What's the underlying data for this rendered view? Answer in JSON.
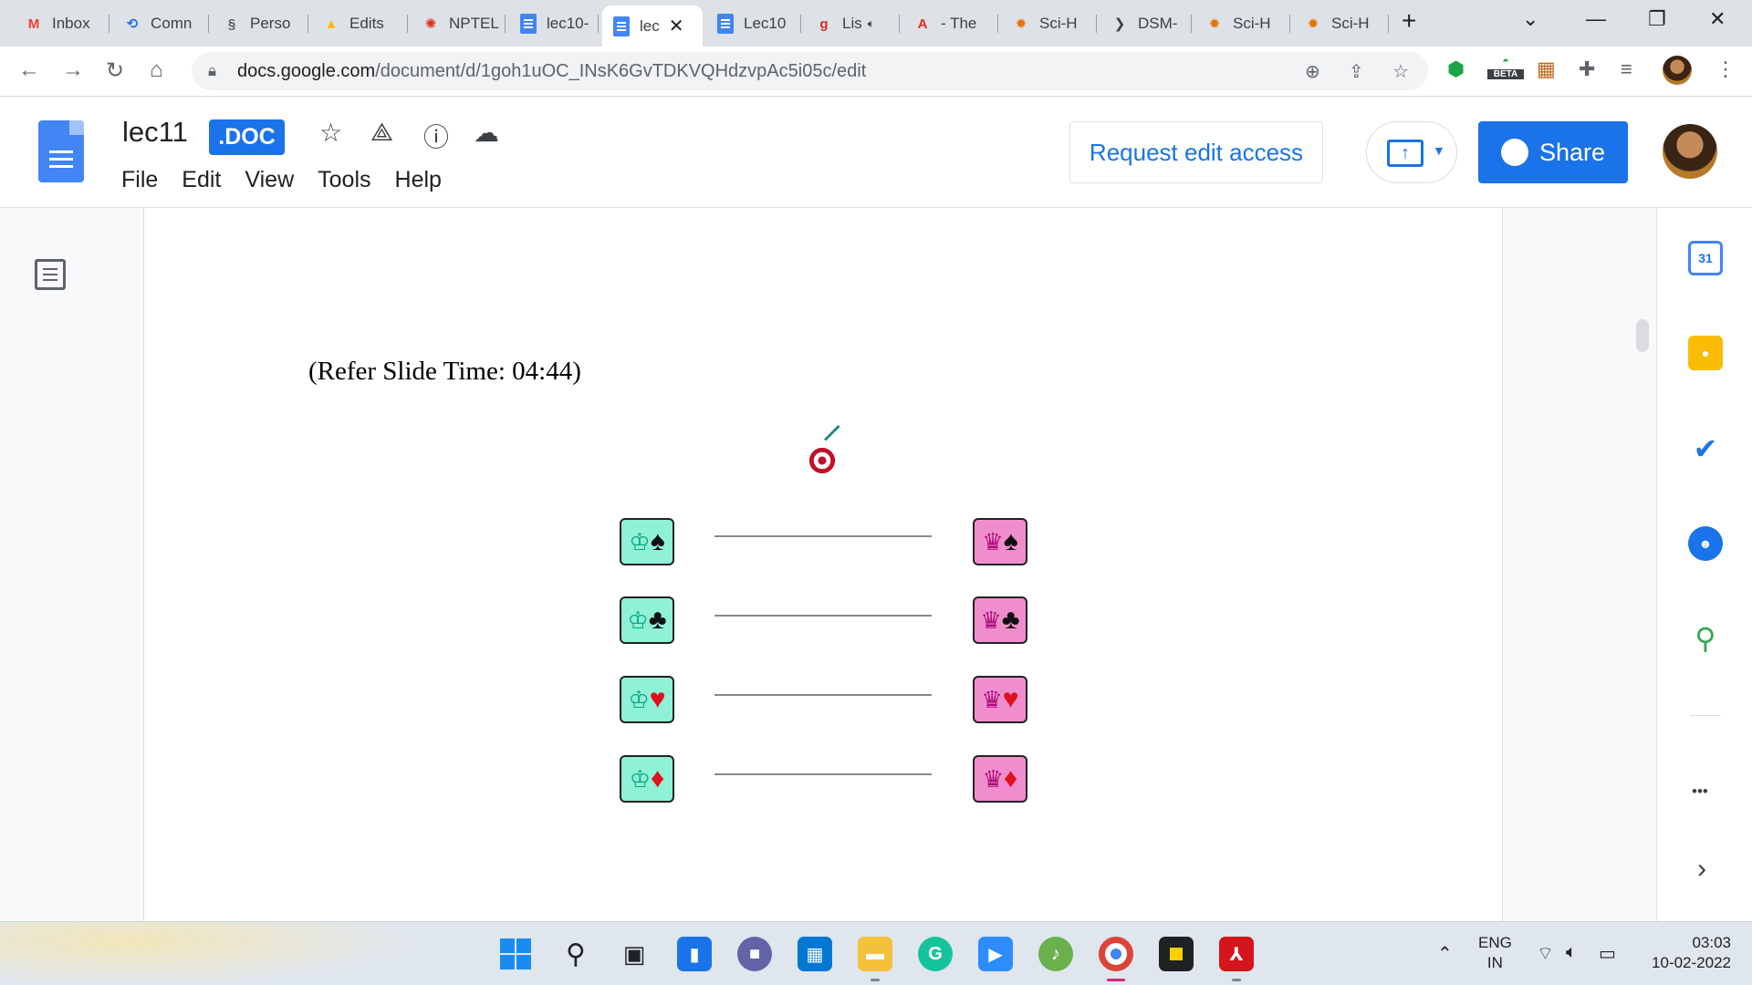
{
  "browser": {
    "tabs": [
      {
        "label": "Inbox",
        "icon": "gmail-icon",
        "favicon_color": "#ea4335",
        "glyph": "M"
      },
      {
        "label": "Comn",
        "icon": "link-icon",
        "favicon_color": "#1a73e8",
        "glyph": "⟲"
      },
      {
        "label": "Perso",
        "icon": "dna-icon",
        "favicon_color": "#5f6368",
        "glyph": "§"
      },
      {
        "label": "Edits",
        "icon": "google-drive-icon",
        "favicon_color": "#fbbc04",
        "glyph": "▲"
      },
      {
        "label": "NPTEL",
        "icon": "nptel-icon",
        "favicon_color": "#d93025",
        "glyph": "✺"
      },
      {
        "label": "lec10-",
        "icon": "docs-icon",
        "favicon_color": "#4285f4",
        "glyph": ""
      },
      {
        "label": "lec",
        "icon": "docs-icon",
        "favicon_color": "#4285f4",
        "glyph": "",
        "active": true
      },
      {
        "label": "Lec10",
        "icon": "docs-icon",
        "favicon_color": "#4285f4",
        "glyph": ""
      },
      {
        "label": "Lis",
        "icon": "g-icon",
        "favicon_color": "#d93025",
        "glyph": "g",
        "audio": true
      },
      {
        "label": "- The",
        "icon": "acrobat-icon",
        "favicon_color": "#d93025",
        "glyph": "A"
      },
      {
        "label": "Sci-H",
        "icon": "scihub-icon",
        "favicon_color": "#e37400",
        "glyph": "✹"
      },
      {
        "label": "DSM-",
        "icon": "dsm-icon",
        "favicon_color": "#3c4043",
        "glyph": "❯"
      },
      {
        "label": "Sci-H",
        "icon": "scihub-icon",
        "favicon_color": "#e37400",
        "glyph": "✹"
      },
      {
        "label": "Sci-H",
        "icon": "scihub-icon",
        "favicon_color": "#e37400",
        "glyph": "✹"
      }
    ],
    "new_tab_glyph": "+",
    "url_host": "docs.google.com",
    "url_path": "/document/d/1goh1uOC_INsK6GvTDKVQHdzvpAc5i05c/edit",
    "beta_badge": "BETA"
  },
  "docs": {
    "title": "lec11",
    "badge": ".DOC",
    "menu": [
      "File",
      "Edit",
      "View",
      "Tools",
      "Help"
    ],
    "request_edit_label": "Request edit access",
    "share_label": "Share"
  },
  "page": {
    "ref_text": "(Refer Slide Time: 04:44)",
    "slide": {
      "rows": [
        {
          "king_suit": "♠",
          "queen_suit": "♠",
          "suit_color": "black"
        },
        {
          "king_suit": "♣",
          "queen_suit": "♣",
          "suit_color": "black"
        },
        {
          "king_suit": "♥",
          "queen_suit": "♥",
          "suit_color": "red"
        },
        {
          "king_suit": "♦",
          "queen_suit": "♦",
          "suit_color": "red"
        }
      ],
      "king_glyph": "♔",
      "queen_glyph": "♛",
      "colors": {
        "king_card": "#8ff2d6",
        "queen_card": "#f08ecd",
        "red_suit": "#e0101d"
      }
    }
  },
  "side_panel": {
    "calendar_day": "31",
    "more_glyph": "•••",
    "expand_glyph": "›"
  },
  "taskbar": {
    "lang_1": "ENG",
    "lang_2": "IN",
    "time": "03:03",
    "date": "10-02-2022"
  }
}
